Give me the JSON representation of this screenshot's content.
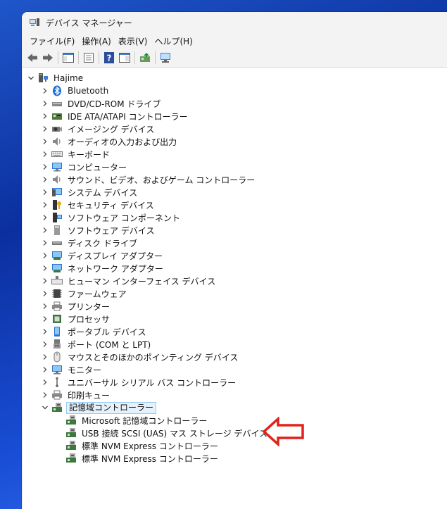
{
  "window": {
    "title": "デバイス マネージャー"
  },
  "menu": [
    "ファイル(F)",
    "操作(A)",
    "表示(V)",
    "ヘルプ(H)"
  ],
  "tree": {
    "root": "Hajime",
    "categories": [
      {
        "label": "Bluetooth",
        "icon": "bluetooth-icon"
      },
      {
        "label": "DVD/CD-ROM ドライブ",
        "icon": "dvd-drive-icon"
      },
      {
        "label": "IDE ATA/ATAPI コントローラー",
        "icon": "ide-controller-icon"
      },
      {
        "label": "イメージング デバイス",
        "icon": "camera-icon"
      },
      {
        "label": "オーディオの入力および出力",
        "icon": "speaker-icon"
      },
      {
        "label": "キーボード",
        "icon": "keyboard-icon"
      },
      {
        "label": "コンピューター",
        "icon": "computer-icon"
      },
      {
        "label": "サウンド、ビデオ、およびゲーム コントローラー",
        "icon": "sound-icon"
      },
      {
        "label": "システム デバイス",
        "icon": "system-device-icon"
      },
      {
        "label": "セキュリティ デバイス",
        "icon": "security-key-icon"
      },
      {
        "label": "ソフトウェア コンポーネント",
        "icon": "software-component-icon"
      },
      {
        "label": "ソフトウェア デバイス",
        "icon": "software-device-icon"
      },
      {
        "label": "ディスク ドライブ",
        "icon": "disk-drive-icon"
      },
      {
        "label": "ディスプレイ アダプター",
        "icon": "display-adapter-icon"
      },
      {
        "label": "ネットワーク アダプター",
        "icon": "network-adapter-icon"
      },
      {
        "label": "ヒューマン インターフェイス デバイス",
        "icon": "hid-icon"
      },
      {
        "label": "ファームウェア",
        "icon": "firmware-icon"
      },
      {
        "label": "プリンター",
        "icon": "printer-icon"
      },
      {
        "label": "プロセッサ",
        "icon": "processor-icon"
      },
      {
        "label": "ポータブル デバイス",
        "icon": "portable-device-icon"
      },
      {
        "label": "ポート (COM と LPT)",
        "icon": "port-icon"
      },
      {
        "label": "マウスとそのほかのポインティング デバイス",
        "icon": "mouse-icon"
      },
      {
        "label": "モニター",
        "icon": "monitor-icon"
      },
      {
        "label": "ユニバーサル シリアル バス コントローラー",
        "icon": "usb-icon"
      },
      {
        "label": "印刷キュー",
        "icon": "print-queue-icon"
      },
      {
        "label": "記憶域コントローラー",
        "icon": "storage-controller-icon",
        "expanded": true,
        "selected": true
      }
    ],
    "storage_children": [
      "Microsoft 記憶域コントローラー",
      "USB 接続 SCSI (UAS) マス ストレージ デバイス",
      "標準 NVM Express コントローラー",
      "標準 NVM Express コントローラー"
    ]
  },
  "annotation": {
    "arrow_color": "#e0231c"
  }
}
